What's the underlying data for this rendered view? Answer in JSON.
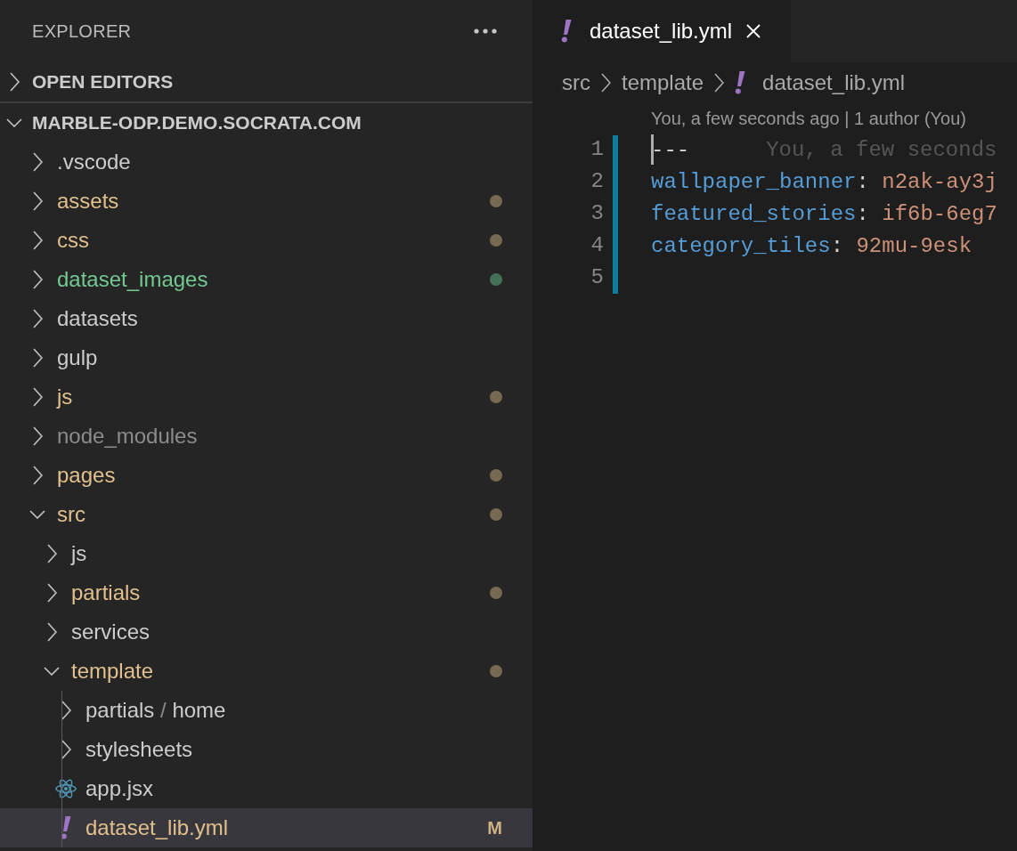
{
  "sidebar": {
    "title": "EXPLORER",
    "sections": [
      {
        "label": "OPEN EDITORS",
        "expanded": false
      },
      {
        "label": "MARBLE-ODP.DEMO.SOCRATA.COM",
        "expanded": true,
        "tree": [
          {
            "name": ".vscode",
            "kind": "folder",
            "expanded": false,
            "modified": false,
            "untracked": false,
            "ignored": false,
            "selected": false
          },
          {
            "name": "assets",
            "kind": "folder",
            "expanded": false,
            "modified": true,
            "untracked": false,
            "ignored": false,
            "selected": false
          },
          {
            "name": "css",
            "kind": "folder",
            "expanded": false,
            "modified": true,
            "untracked": false,
            "ignored": false,
            "selected": false
          },
          {
            "name": "dataset_images",
            "kind": "folder",
            "expanded": false,
            "modified": false,
            "untracked": true,
            "ignored": false,
            "selected": false
          },
          {
            "name": "datasets",
            "kind": "folder",
            "expanded": false,
            "modified": false,
            "untracked": false,
            "ignored": false,
            "selected": false
          },
          {
            "name": "gulp",
            "kind": "folder",
            "expanded": false,
            "modified": false,
            "untracked": false,
            "ignored": false,
            "selected": false
          },
          {
            "name": "js",
            "kind": "folder",
            "expanded": false,
            "modified": true,
            "untracked": false,
            "ignored": false,
            "selected": false
          },
          {
            "name": "node_modules",
            "kind": "folder",
            "expanded": false,
            "modified": false,
            "untracked": false,
            "ignored": true,
            "selected": false
          },
          {
            "name": "pages",
            "kind": "folder",
            "expanded": false,
            "modified": true,
            "untracked": false,
            "ignored": false,
            "selected": false
          },
          {
            "name": "src",
            "kind": "folder",
            "expanded": true,
            "modified": true,
            "untracked": false,
            "ignored": false,
            "selected": false,
            "children": [
              {
                "name": "js",
                "kind": "folder",
                "expanded": false,
                "modified": false,
                "untracked": false,
                "ignored": false,
                "selected": false
              },
              {
                "name": "partials",
                "kind": "folder",
                "expanded": false,
                "modified": true,
                "untracked": false,
                "ignored": false,
                "selected": false
              },
              {
                "name": "services",
                "kind": "folder",
                "expanded": false,
                "modified": false,
                "untracked": false,
                "ignored": false,
                "selected": false
              },
              {
                "name": "template",
                "kind": "folder",
                "expanded": true,
                "modified": true,
                "untracked": false,
                "ignored": false,
                "selected": false,
                "children": [
                  {
                    "path": [
                      "partials",
                      "home"
                    ],
                    "separator": "/",
                    "kind": "folder",
                    "expanded": false,
                    "modified": false,
                    "untracked": false,
                    "ignored": false,
                    "selected": false
                  },
                  {
                    "name": "stylesheets",
                    "kind": "folder",
                    "expanded": false,
                    "modified": false,
                    "untracked": false,
                    "ignored": false,
                    "selected": false
                  },
                  {
                    "name": "app.jsx",
                    "kind": "react-file",
                    "modified": false,
                    "untracked": false,
                    "ignored": false,
                    "selected": false
                  },
                  {
                    "name": "dataset_lib.yml",
                    "kind": "yaml-file",
                    "modified": true,
                    "untracked": false,
                    "ignored": false,
                    "badge": "M",
                    "selected": true
                  }
                ]
              }
            ]
          }
        ]
      }
    ]
  },
  "editor": {
    "tabs": [
      {
        "label": "dataset_lib.yml",
        "kind": "yaml-file",
        "selected": true
      }
    ],
    "breadcrumbs": [
      {
        "label": "src",
        "kind": "folder"
      },
      {
        "label": "template",
        "kind": "folder"
      },
      {
        "label": "dataset_lib.yml",
        "kind": "yaml-file"
      }
    ],
    "codelens": "You, a few seconds ago | 1 author (You)",
    "lines_added": true,
    "lines": [
      {
        "number": "1",
        "cursor": true,
        "tokens": [
          {
            "text": "---",
            "kind": "plain"
          }
        ],
        "blame": "You, a few seconds"
      },
      {
        "number": "2",
        "cursor": false,
        "tokens": [
          {
            "text": "wallpaper_banner",
            "kind": "key"
          },
          {
            "text": ":",
            "kind": "punct"
          },
          {
            "text": "n2ak-ay3j",
            "kind": "value"
          }
        ]
      },
      {
        "number": "3",
        "cursor": false,
        "tokens": [
          {
            "text": "featured_stories",
            "kind": "key"
          },
          {
            "text": ":",
            "kind": "punct"
          },
          {
            "text": "if6b-6eg7",
            "kind": "value"
          }
        ]
      },
      {
        "number": "4",
        "cursor": false,
        "tokens": [
          {
            "text": "category_tiles",
            "kind": "key"
          },
          {
            "text": ":",
            "kind": "punct"
          },
          {
            "text": "92mu-9esk",
            "kind": "value"
          }
        ]
      },
      {
        "number": "5",
        "cursor": false
      }
    ]
  }
}
